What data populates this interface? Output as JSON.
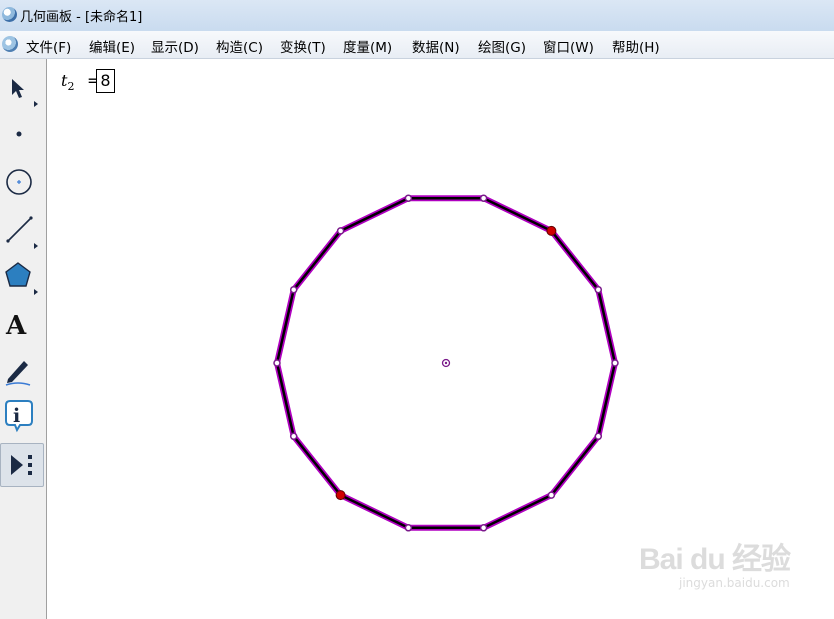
{
  "window": {
    "title": "几何画板 - [未命名1]"
  },
  "menu": {
    "items": [
      {
        "label": "文件(F)"
      },
      {
        "label": "编辑(E)"
      },
      {
        "label": "显示(D)"
      },
      {
        "label": "构造(C)"
      },
      {
        "label": "变换(T)"
      },
      {
        "label": "度量(M)"
      },
      {
        "label": "数据(N)"
      },
      {
        "label": "绘图(G)"
      },
      {
        "label": "窗口(W)"
      },
      {
        "label": "帮助(H)"
      }
    ]
  },
  "toolbox": {
    "tools": [
      {
        "icon": "arrow-select-icon"
      },
      {
        "icon": "point-icon"
      },
      {
        "icon": "compass-circle-icon"
      },
      {
        "icon": "straightedge-icon"
      },
      {
        "icon": "polygon-icon"
      },
      {
        "icon": "text-tool-icon",
        "glyph": "A"
      },
      {
        "icon": "marker-pen-icon"
      },
      {
        "icon": "information-icon",
        "glyph": "i"
      },
      {
        "icon": "custom-tool-icon",
        "active": true
      }
    ]
  },
  "canvas": {
    "parameter": {
      "name": "t",
      "subscript": "2",
      "equals": "=",
      "value": "8"
    },
    "figure": {
      "sides": 14,
      "edge_color": "#000000",
      "highlight_color": "#b000c0",
      "selected_vertex_color": "#d00000",
      "vertex_color": "#7a1a8a"
    }
  },
  "watermark": {
    "logo": "Bai du 经验",
    "url": "jingyan.baidu.com"
  }
}
